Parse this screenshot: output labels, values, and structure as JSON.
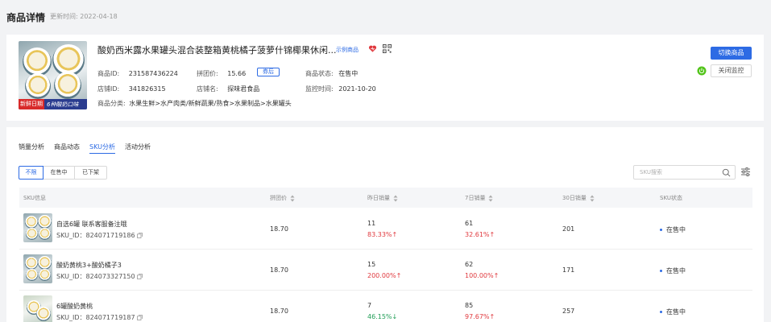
{
  "header": {
    "title": "商品详情",
    "update_time": "更新时间: 2022-04-18"
  },
  "product": {
    "image_tag_left": "新鲜日期",
    "image_tag_right": "6种酸奶口味",
    "title": "酸奶西米露水果罐头混合装整箱黄桃橘子菠萝什锦椰果休闲...",
    "demo_link": "示例商品",
    "id_label": "商品ID:",
    "id_value": "231587436224",
    "group_price_label": "拼团价:",
    "group_price_value": "15.66",
    "coupon_label": "券后",
    "status_label": "商品状态:",
    "status_value": "在售中",
    "shop_id_label": "店铺ID:",
    "shop_id_value": "341826315",
    "shop_name_label": "店铺名:",
    "shop_name_value": "探味君食品",
    "monitor_label": "监控时间:",
    "monitor_value": "2021-10-20",
    "category_label": "商品分类:",
    "category_value": "水果生鲜>水产肉类/新鲜蔬果/熟食>水果制品>水果罐头",
    "switch_button": "切换商品",
    "close_monitor_button": "关闭监控",
    "colors": {
      "accent": "#2d6be4",
      "power_on": "#52c41a",
      "heart": "#e0393e"
    }
  },
  "tabs": [
    "销量分析",
    "商品动态",
    "SKU分析",
    "活动分析"
  ],
  "active_tab": "SKU分析",
  "filters": [
    "不限",
    "在售中",
    "已下架"
  ],
  "active_filter": "不限",
  "search": {
    "placeholder": "SKU搜索"
  },
  "table": {
    "headers": [
      "SKU信息",
      "拼团价",
      "昨日销量",
      "7日销量",
      "30日销量",
      "SKU状态"
    ],
    "rows": [
      {
        "name": "自选6罐 联系客服备注哦",
        "sku_id": "SKU_ID：824071719186",
        "price": "18.70",
        "yesterday": "11",
        "yesterday_change": "83.33%↑",
        "week": "61",
        "week_change": "32.61%↑",
        "month": "201",
        "status": "在售中"
      },
      {
        "name": "酸奶黄桃3+酸奶橘子3",
        "sku_id": "SKU_ID：824073327150",
        "price": "18.70",
        "yesterday": "15",
        "yesterday_change": "200.00%↑",
        "week": "62",
        "week_change": "100.00%↑",
        "month": "171",
        "status": "在售中"
      },
      {
        "name": "6罐酸奶黄桃",
        "sku_id": "SKU_ID：824071719187",
        "price": "18.70",
        "yesterday": "7",
        "yesterday_change": "46.15%↓",
        "week": "85",
        "week_change": "97.67%↑",
        "month": "257",
        "status": "在售中"
      }
    ]
  }
}
